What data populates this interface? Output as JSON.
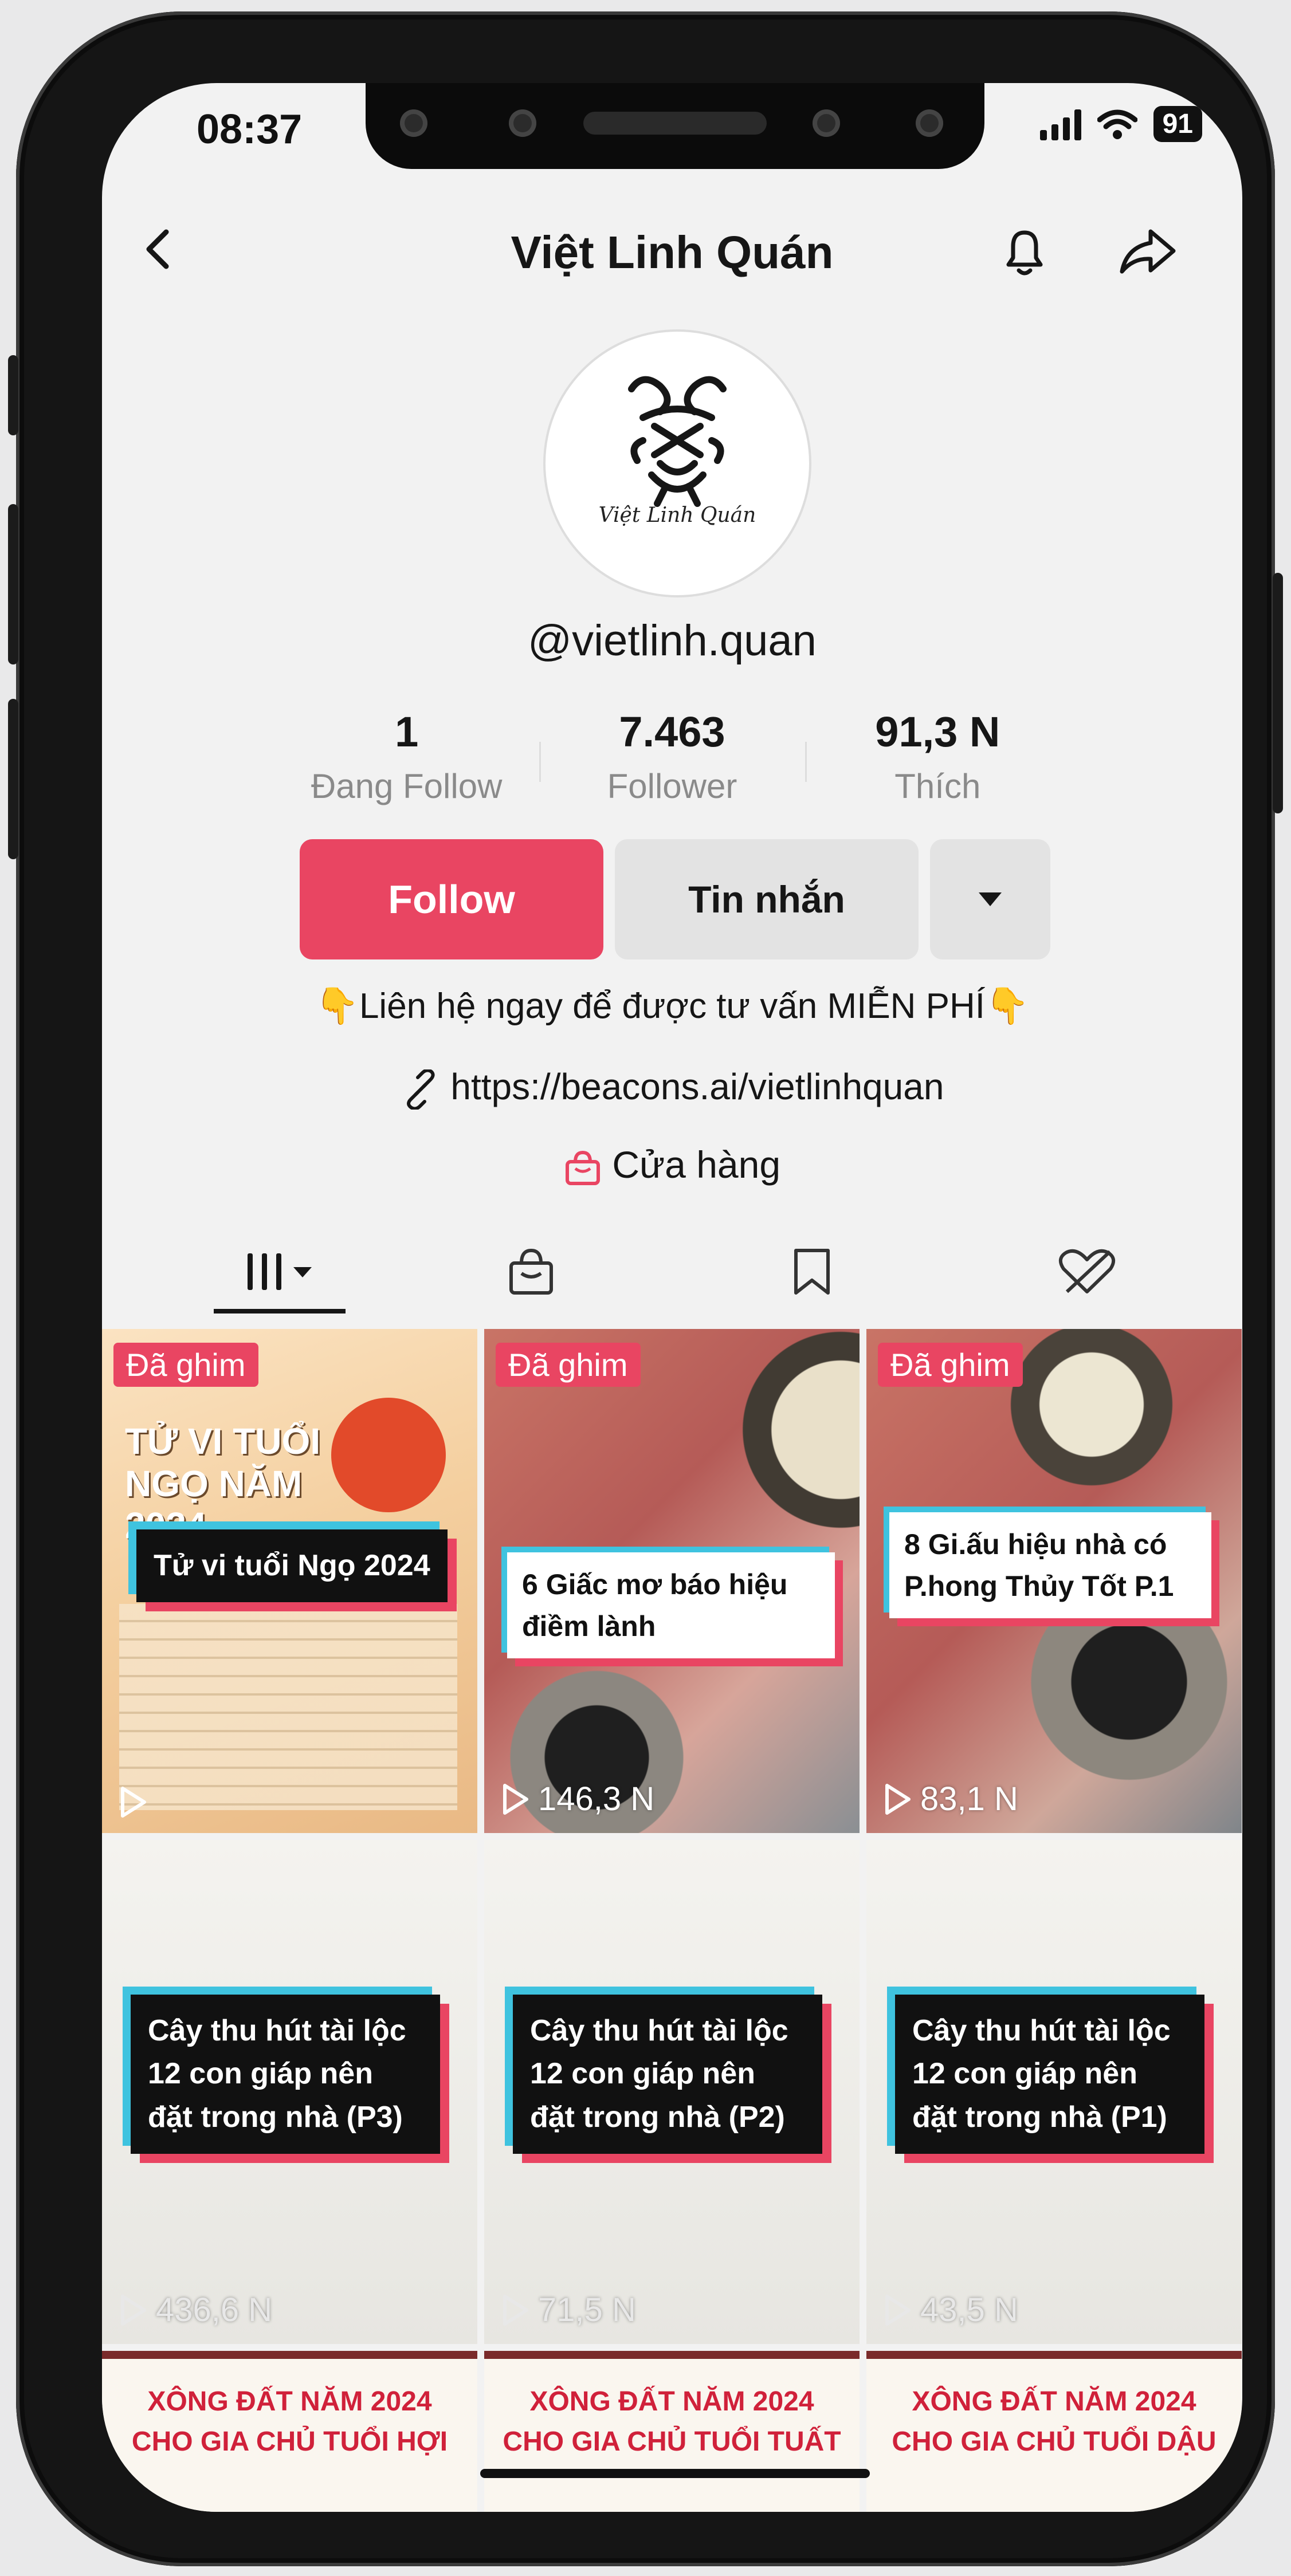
{
  "status": {
    "time": "08:37",
    "battery": "91"
  },
  "header": {
    "title": "Việt Linh Quán"
  },
  "profile": {
    "avatar_text": "Việt Linh Quán",
    "username": "@vietlinh.quan",
    "stats": [
      {
        "value": "1",
        "label": "Đang Follow"
      },
      {
        "value": "7.463",
        "label": "Follower"
      },
      {
        "value": "91,3 N",
        "label": "Thích"
      }
    ],
    "follow_label": "Follow",
    "message_label": "Tin nhắn",
    "bio": "👇Liên hệ ngay để được tư vấn MIỄN PHÍ👇",
    "link": "https://beacons.ai/vietlinhquan",
    "shop_label": "Cửa hàng"
  },
  "colors": {
    "accent": "#e94562",
    "cyan": "#3fc3df"
  },
  "videos": {
    "row1": [
      {
        "pinned": "Đã ghim",
        "poster_title": "TỬ VI TUỔI NGỌ NĂM 2024",
        "caption": "Tử vi tuổi Ngọ 2024",
        "views": ""
      },
      {
        "pinned": "Đã ghim",
        "caption": "6 Giấc mơ báo hiệu điềm lành",
        "views": "146,3 N"
      },
      {
        "pinned": "Đã ghim",
        "caption": "8 Gi.ấu hiệu nhà có P.hong Thủy Tốt P.1",
        "views": "83,1 N"
      }
    ],
    "row2": [
      {
        "caption": "Cây thu hút tài lộc 12 con giáp nên đặt trong nhà (P3)",
        "views": "436,6 N"
      },
      {
        "caption": "Cây thu hút tài lộc 12 con giáp nên đặt trong nhà (P2)",
        "views": "71,5 N"
      },
      {
        "caption": "Cây thu hút tài lộc 12 con giáp nên đặt trong nhà (P1)",
        "views": "43,5 N"
      }
    ],
    "row3": [
      {
        "title": "XÔNG ĐẤT NĂM 2024 CHO GIA CHỦ TUỔI HỢI"
      },
      {
        "title": "XÔNG ĐẤT NĂM 2024 CHO GIA CHỦ TUỔI TUẤT"
      },
      {
        "title": "XÔNG ĐẤT NĂM 2024 CHO GIA CHỦ TUỔI DẬU"
      }
    ]
  },
  "icons": [
    "back-arrow-icon",
    "bell-icon",
    "share-icon",
    "dropdown-arrow-icon",
    "link-icon",
    "shop-bag-icon",
    "grid-tab-icon",
    "shop-tab-icon",
    "bookmark-tab-icon",
    "liked-tab-icon",
    "play-icon"
  ]
}
